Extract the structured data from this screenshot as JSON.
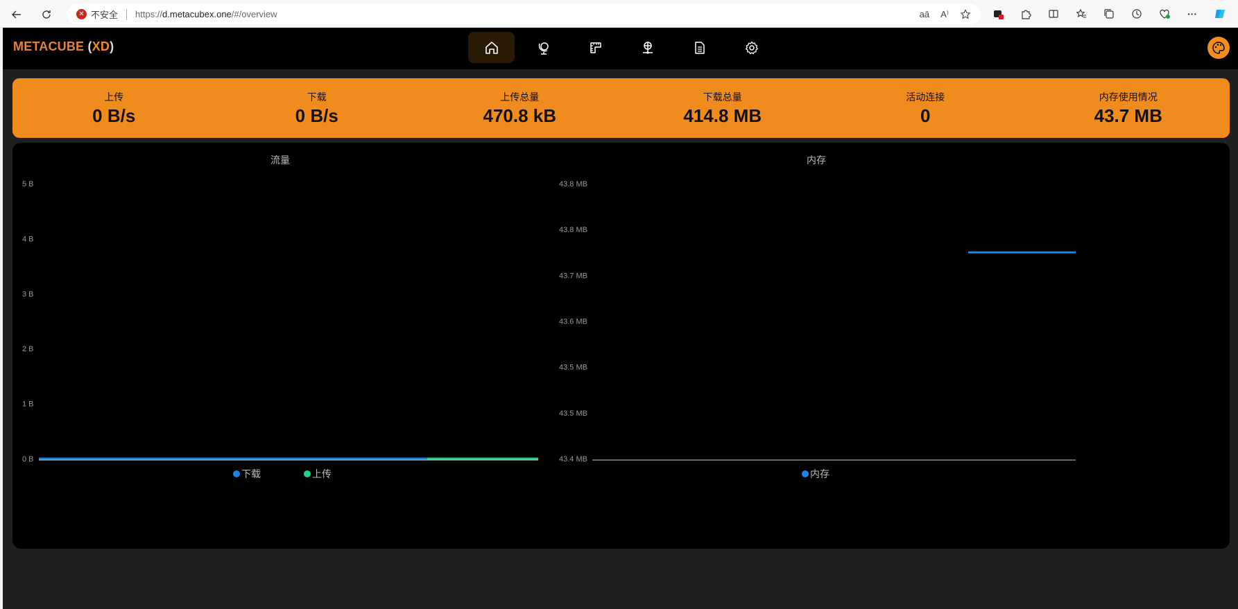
{
  "browser": {
    "security_label": "不安全",
    "url_prefix": "https://",
    "url_host": "d.metacubex.one",
    "url_path": "/#/overview",
    "read_aloud": "A⁾",
    "translate": "aā"
  },
  "app": {
    "logo_main": "METACUBE",
    "logo_paren_open": "(",
    "logo_xd": "XD",
    "logo_paren_close": ")"
  },
  "nav": {
    "tabs": [
      {
        "icon": "home-icon",
        "active": true
      },
      {
        "icon": "globe-icon",
        "active": false
      },
      {
        "icon": "rules-icon",
        "active": false
      },
      {
        "icon": "connections-icon",
        "active": false
      },
      {
        "icon": "logs-icon",
        "active": false
      },
      {
        "icon": "settings-icon",
        "active": false
      }
    ]
  },
  "stats": [
    {
      "label": "上传",
      "value": "0 B/s"
    },
    {
      "label": "下载",
      "value": "0 B/s"
    },
    {
      "label": "上传总量",
      "value": "470.8 kB"
    },
    {
      "label": "下载总量",
      "value": "414.8 MB"
    },
    {
      "label": "活动连接",
      "value": "0"
    },
    {
      "label": "内存使用情况",
      "value": "43.7 MB"
    }
  ],
  "colors": {
    "accent": "#f08b1d",
    "download": "#1a84e6",
    "upload": "#1ed38c",
    "memory": "#1a84e6"
  },
  "chart_data": [
    {
      "type": "line",
      "title": "流量",
      "yticks": [
        "0 B",
        "1 B",
        "2 B",
        "3 B",
        "4 B",
        "5 B"
      ],
      "ylim": [
        0,
        5
      ],
      "series": [
        {
          "name": "下载",
          "color": "#1a84e6",
          "values": [
            0,
            0,
            0,
            0,
            0,
            0,
            0,
            0,
            0,
            0
          ]
        },
        {
          "name": "上传",
          "color": "#1ed38c",
          "values": [
            null,
            null,
            null,
            null,
            null,
            null,
            null,
            0,
            0,
            0
          ]
        }
      ]
    },
    {
      "type": "line",
      "title": "内存",
      "yticks": [
        "43.4 MB",
        "43.5 MB",
        "43.5 MB",
        "43.6 MB",
        "43.7 MB",
        "43.8 MB",
        "43.8 MB"
      ],
      "ylim": [
        43.4,
        43.8
      ],
      "series": [
        {
          "name": "内存",
          "color": "#1a84e6",
          "values": [
            null,
            null,
            null,
            null,
            null,
            null,
            null,
            43.7,
            43.7,
            43.7
          ]
        }
      ]
    }
  ]
}
